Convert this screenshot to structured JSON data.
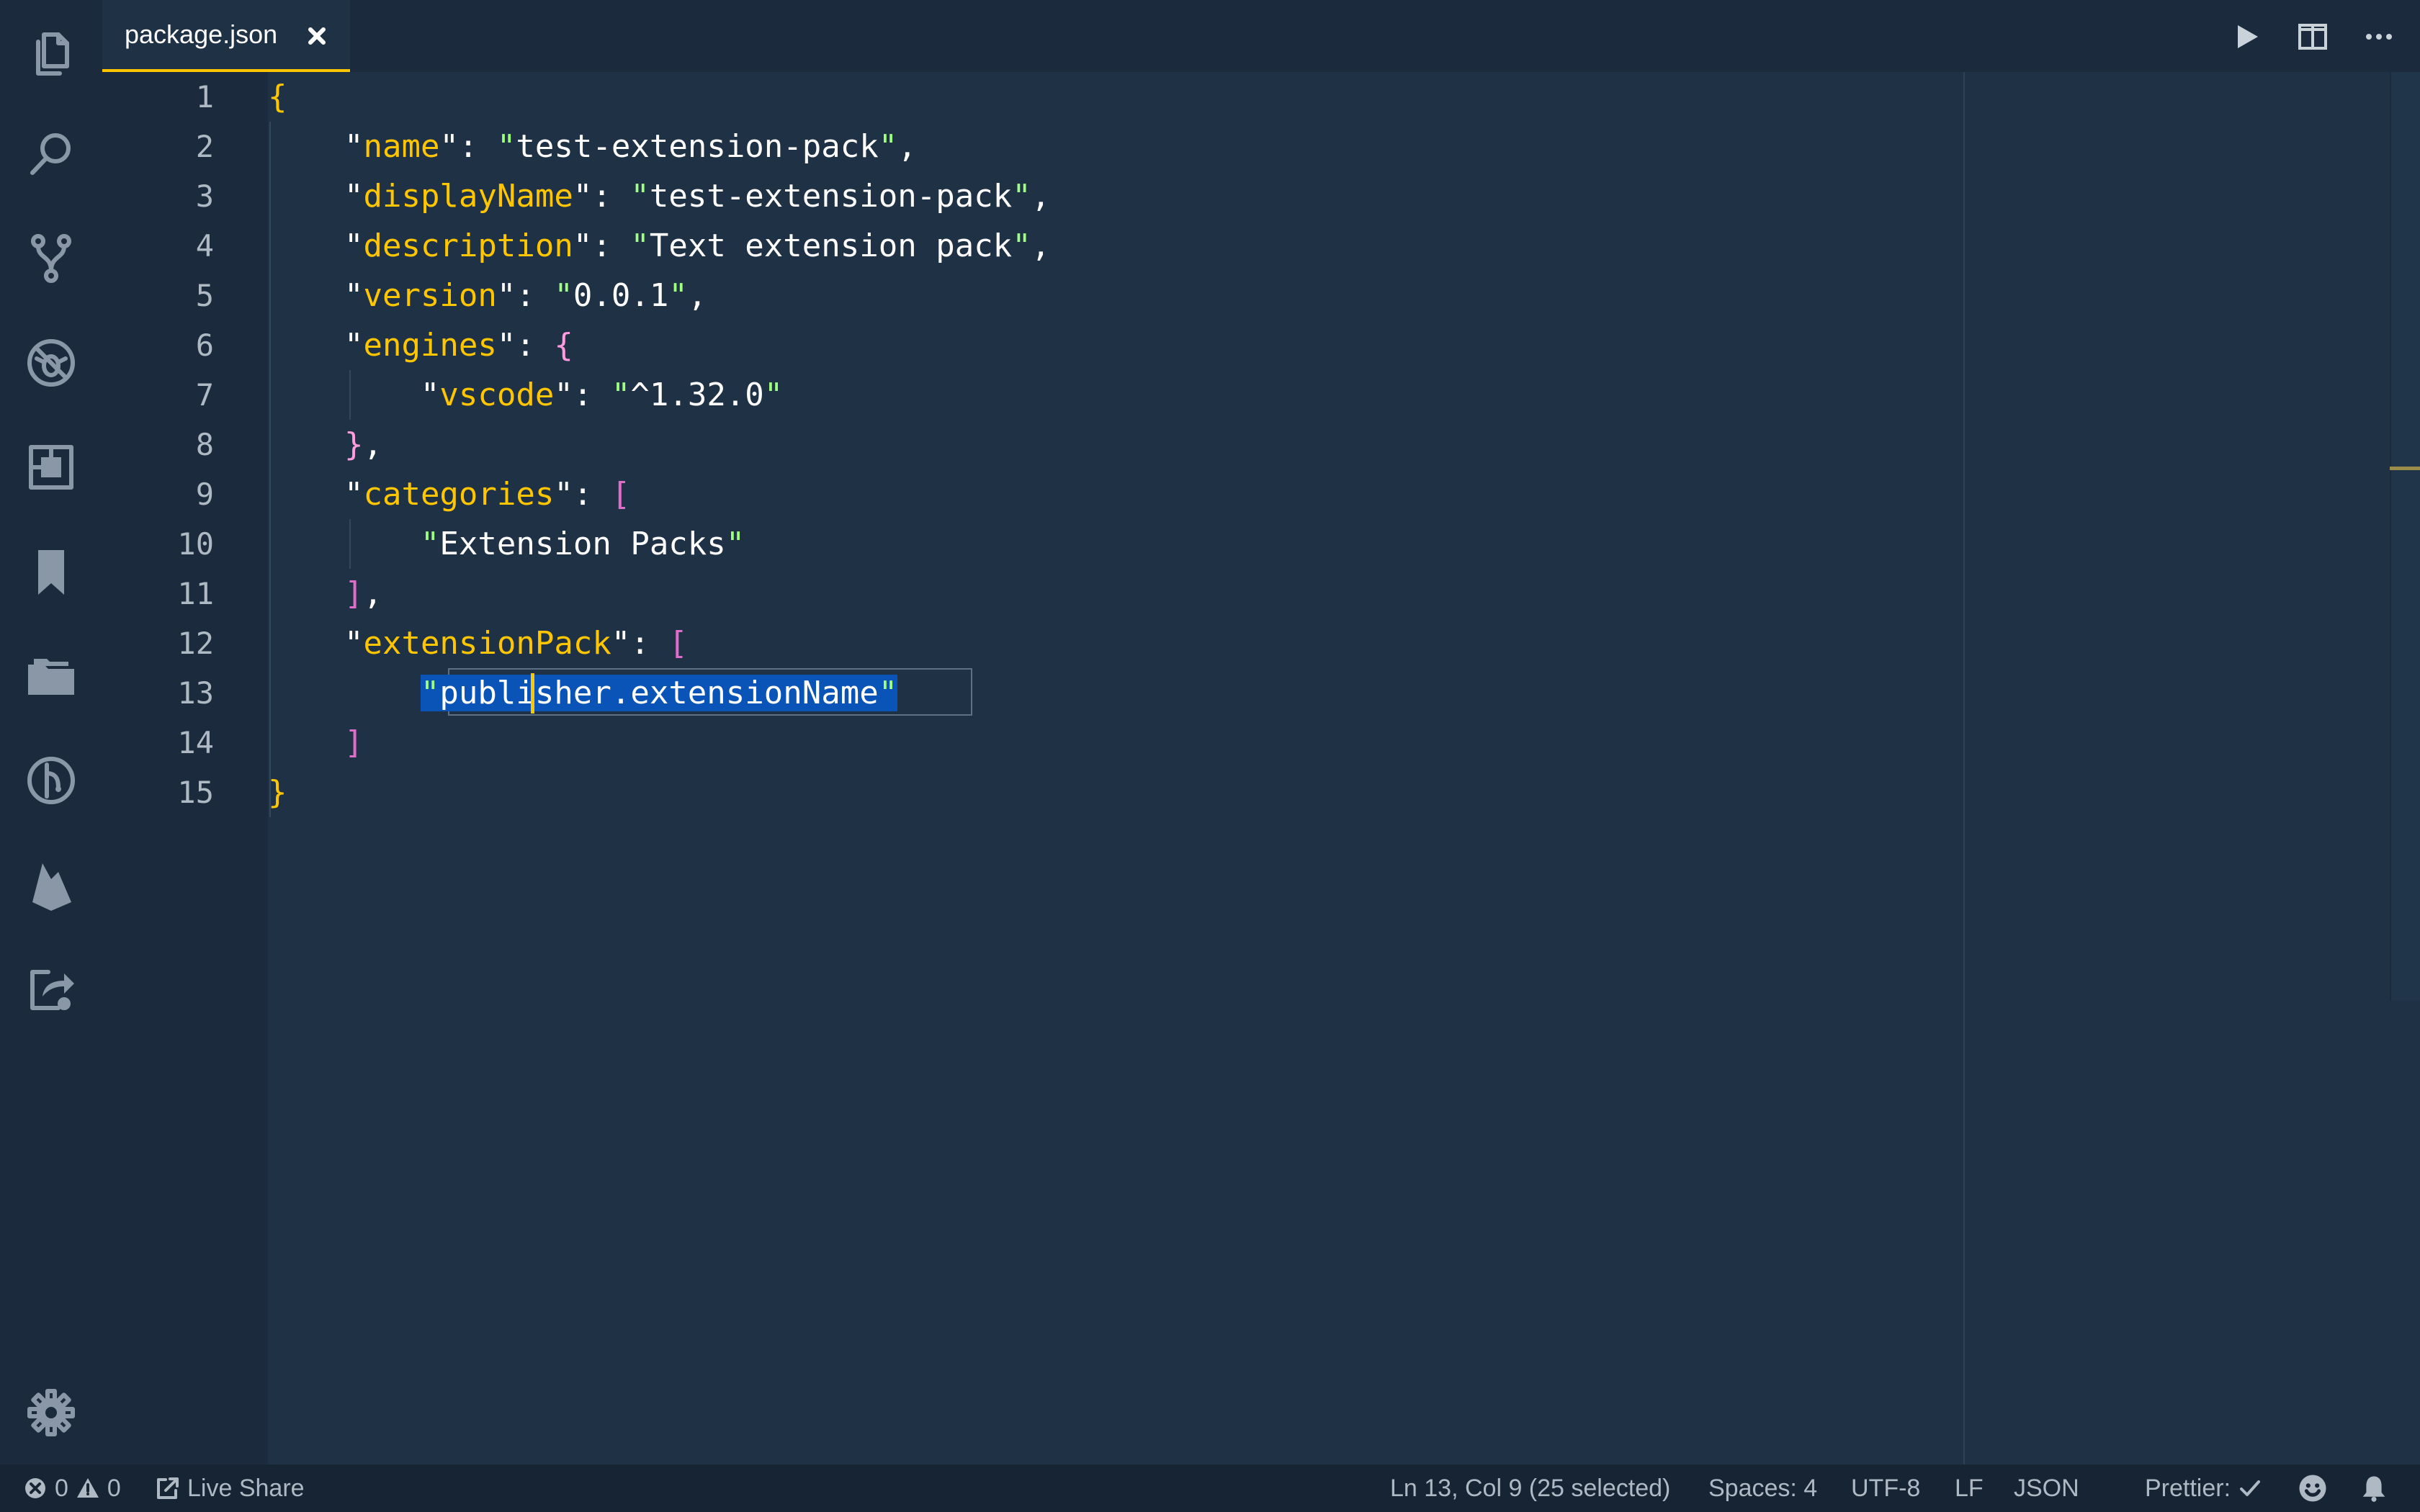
{
  "activity_bar": {
    "icons": [
      "explorer-icon",
      "search-icon",
      "source-control-icon",
      "debug-icon",
      "extensions-icon",
      "bookmarks-icon",
      "project-manager-icon",
      "gitlens-icon",
      "firebase-icon",
      "live-share-icon",
      "settings-gear-icon"
    ]
  },
  "tabs": [
    {
      "label": "package.json",
      "active": true
    }
  ],
  "editor": {
    "line_numbers": [
      "1",
      "2",
      "3",
      "4",
      "5",
      "6",
      "7",
      "8",
      "9",
      "10",
      "11",
      "12",
      "13",
      "14",
      "15"
    ],
    "code": {
      "l1_brace": "{",
      "l2_key": "name",
      "l2_val": "test-extension-pack",
      "l3_key": "displayName",
      "l3_val": "test-extension-pack",
      "l4_key": "description",
      "l4_val": "Text extension pack",
      "l5_key": "version",
      "l5_val": "0.0.1",
      "l6_key": "engines",
      "l6_open": "{",
      "l7_key": "vscode",
      "l7_val": "^1.32.0",
      "l8_close": "}",
      "l9_key": "categories",
      "l9_open": "[",
      "l10_val": "Extension Packs",
      "l11_close": "]",
      "l12_key": "extensionPack",
      "l12_open": "[",
      "l13_val": "publisher.extensionName",
      "l14_close": "]",
      "l15_brace": "}"
    }
  },
  "status_bar": {
    "errors": "0",
    "warnings": "0",
    "live_share": "Live Share",
    "cursor_position": "Ln 13, Col 9 (25 selected)",
    "spaces": "Spaces: 4",
    "encoding": "UTF-8",
    "eol": "LF",
    "language": "JSON",
    "prettier": "Prettier:"
  },
  "colors": {
    "accent": "#ffc600",
    "editor_bg": "#1f3145",
    "sidebar_bg": "#1b2b3d",
    "string": "#9eff80",
    "selection": "#0a54b8",
    "bracket": "#ff9bde"
  }
}
